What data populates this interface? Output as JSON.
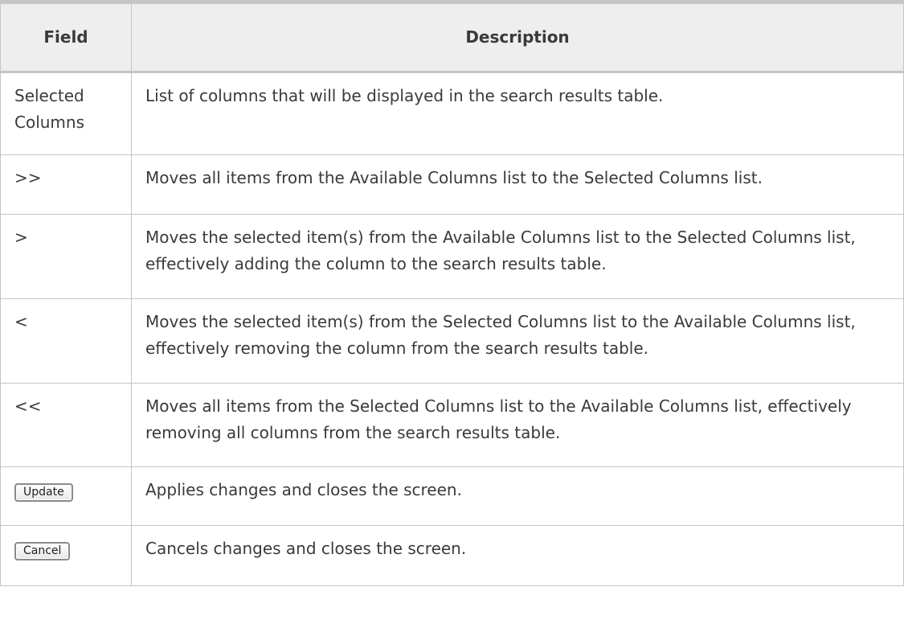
{
  "table": {
    "headers": {
      "field": "Field",
      "description": "Description"
    },
    "rows": [
      {
        "field": "Selected Columns",
        "description": "List of columns that will be displayed in the search results table."
      },
      {
        "field": ">>",
        "description": "Moves all items from the Available Columns list to the Selected Columns list."
      },
      {
        "field": ">",
        "description": "Moves the selected item(s) from the Available Columns list to the Selected Columns list, effectively adding the column to the search results table."
      },
      {
        "field": "<",
        "description": "Moves the selected item(s) from the Selected Columns list to the Available Columns list, effectively removing the column from the search results table."
      },
      {
        "field": "<<",
        "description": "Moves all items from the Selected Columns list to the Available Columns list, effectively removing all columns from the search results table."
      },
      {
        "button_label": "Update",
        "description": "Applies changes and closes the screen."
      },
      {
        "button_label": "Cancel",
        "description": "Cancels changes and closes the screen."
      }
    ]
  }
}
